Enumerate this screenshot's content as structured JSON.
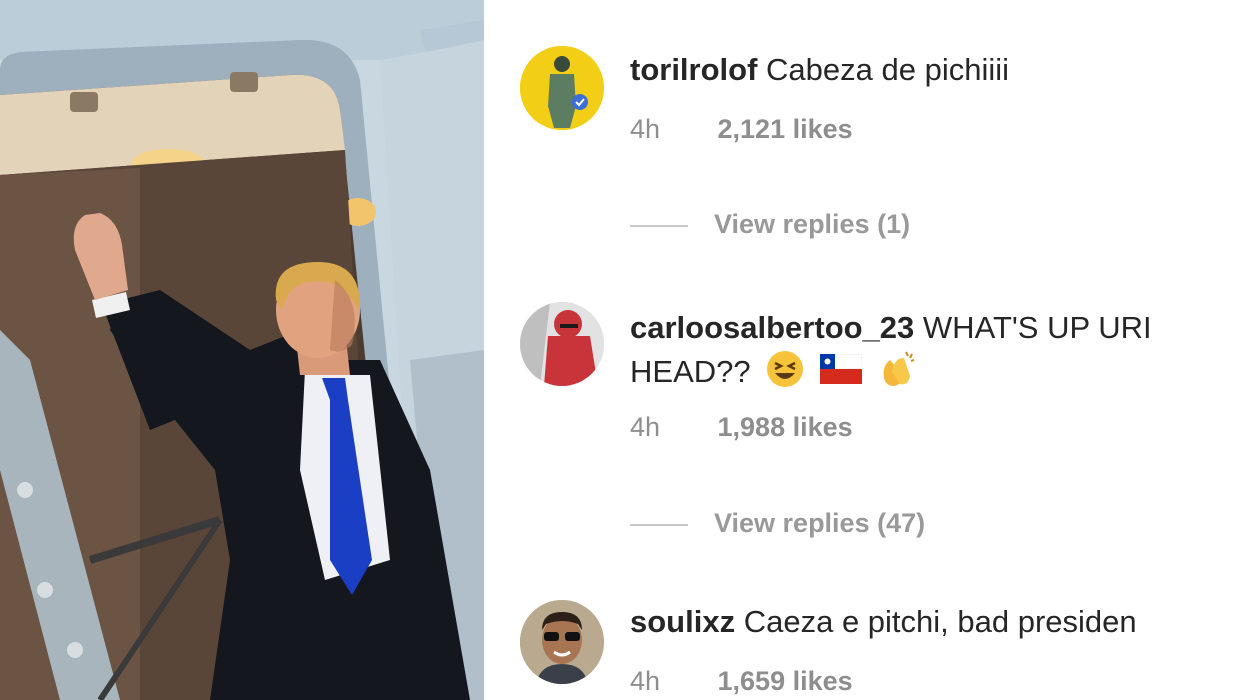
{
  "comments": [
    {
      "username": "torilrolof",
      "text": "Cabeza de pichiiii",
      "time": "4h",
      "likes": "2,121 likes",
      "view_replies": "View replies (1)",
      "avatar_bg": "#f2cf16"
    },
    {
      "username": "carloosalbertoo_23",
      "text_line1": "WHAT'S UP URI",
      "text_line2": "HEAD??",
      "emojis": [
        "laughing-face",
        "chile-flag",
        "clapping-hands"
      ],
      "time": "4h",
      "likes": "1,988 likes",
      "view_replies": "View replies (47)",
      "avatar_bg": "#d9d9d9"
    },
    {
      "username": "soulixz",
      "text": "Caeza e pitchi, bad presiden",
      "time": "4h",
      "likes": "1,659 likes",
      "avatar_bg": "#c9b79c"
    }
  ],
  "colors": {
    "username": "#262626",
    "meta": "#8e8e8e",
    "view_replies": "#999999",
    "divider": "#c7c7c7",
    "tie": "#1a3fc4",
    "coat": "#15171f"
  }
}
